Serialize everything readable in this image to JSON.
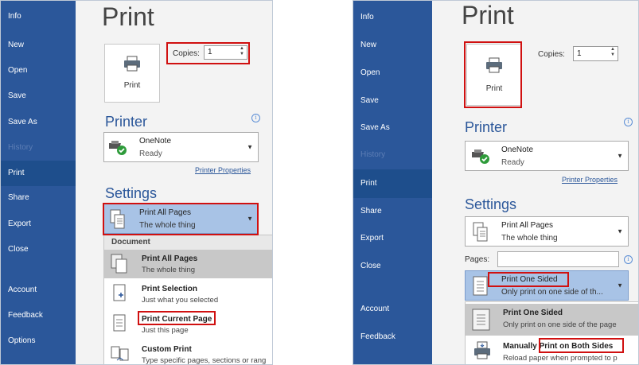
{
  "left": {
    "nav": [
      "Info",
      "New",
      "Open",
      "Save",
      "Save As",
      "History",
      "Print",
      "Share",
      "Export",
      "Close",
      "Account",
      "Feedback",
      "Options"
    ],
    "title": "Print",
    "print_button": "Print",
    "copies_label": "Copies:",
    "copies_value": "1",
    "printer_heading": "Printer",
    "printer_name": "OneNote",
    "printer_status": "Ready",
    "printer_properties": "Printer Properties",
    "settings_heading": "Settings",
    "pages_select": {
      "title": "Print All Pages",
      "subtitle": "The whole thing"
    },
    "menu": {
      "header": "Document",
      "items": [
        {
          "title": "Print All Pages",
          "subtitle": "The whole thing"
        },
        {
          "title": "Print Selection",
          "subtitle": "Just what you selected"
        },
        {
          "title": "Print Current Page",
          "subtitle": "Just this page"
        },
        {
          "title": "Custom Print",
          "subtitle": "Type specific pages, sections or rang"
        }
      ]
    }
  },
  "right": {
    "nav": [
      "Info",
      "New",
      "Open",
      "Save",
      "Save As",
      "History",
      "Print",
      "Share",
      "Export",
      "Close",
      "Account",
      "Feedback"
    ],
    "title": "Print",
    "print_button": "Print",
    "copies_label": "Copies:",
    "copies_value": "1",
    "printer_heading": "Printer",
    "printer_name": "OneNote",
    "printer_status": "Ready",
    "printer_properties": "Printer Properties",
    "settings_heading": "Settings",
    "pages_select": {
      "title": "Print All Pages",
      "subtitle": "The whole thing"
    },
    "pages_label": "Pages:",
    "sided_select": {
      "title": "Print One Sided",
      "subtitle": "Only print on one side of th..."
    },
    "menu": {
      "items": [
        {
          "title": "Print One Sided",
          "subtitle": "Only print on one side of the page"
        },
        {
          "title": "Manually Print on Both Sides",
          "subtitle": "Reload paper when prompted to p"
        }
      ]
    }
  },
  "colors": {
    "sidebar": "#2b579a",
    "selected_nav": "#1e4e8c",
    "highlight": "#a8c3e6",
    "callout": "#d01010"
  }
}
